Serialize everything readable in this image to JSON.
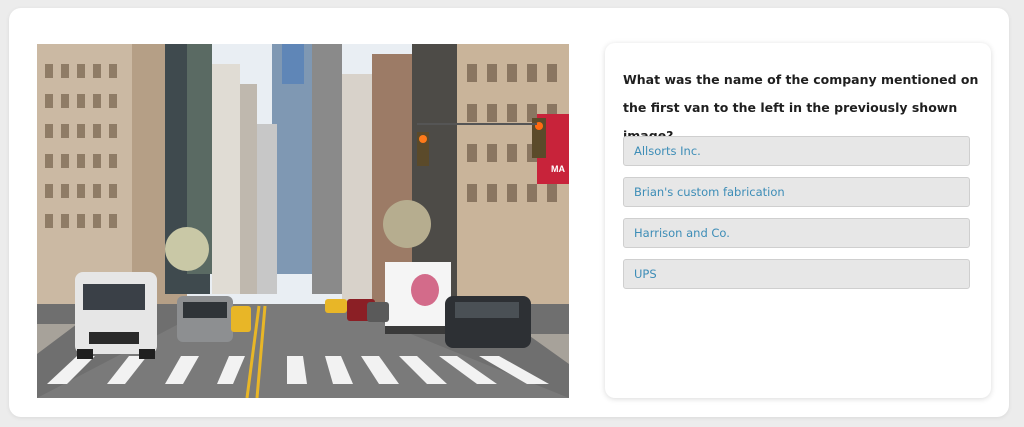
{
  "quiz": {
    "question": "What was the name of the company mentioned on the first van to the left in the previously shown image?",
    "options": [
      {
        "label": "Allsorts Inc."
      },
      {
        "label": "Brian's custom fabrication"
      },
      {
        "label": "Harrison and Co."
      },
      {
        "label": "UPS"
      }
    ]
  },
  "image": {
    "description_icon": "city-street-photo",
    "sign_text": "MA"
  },
  "colors": {
    "option_text": "#3d8db7",
    "option_bg": "#e7e7e7",
    "question_text": "#1f1f1f"
  }
}
